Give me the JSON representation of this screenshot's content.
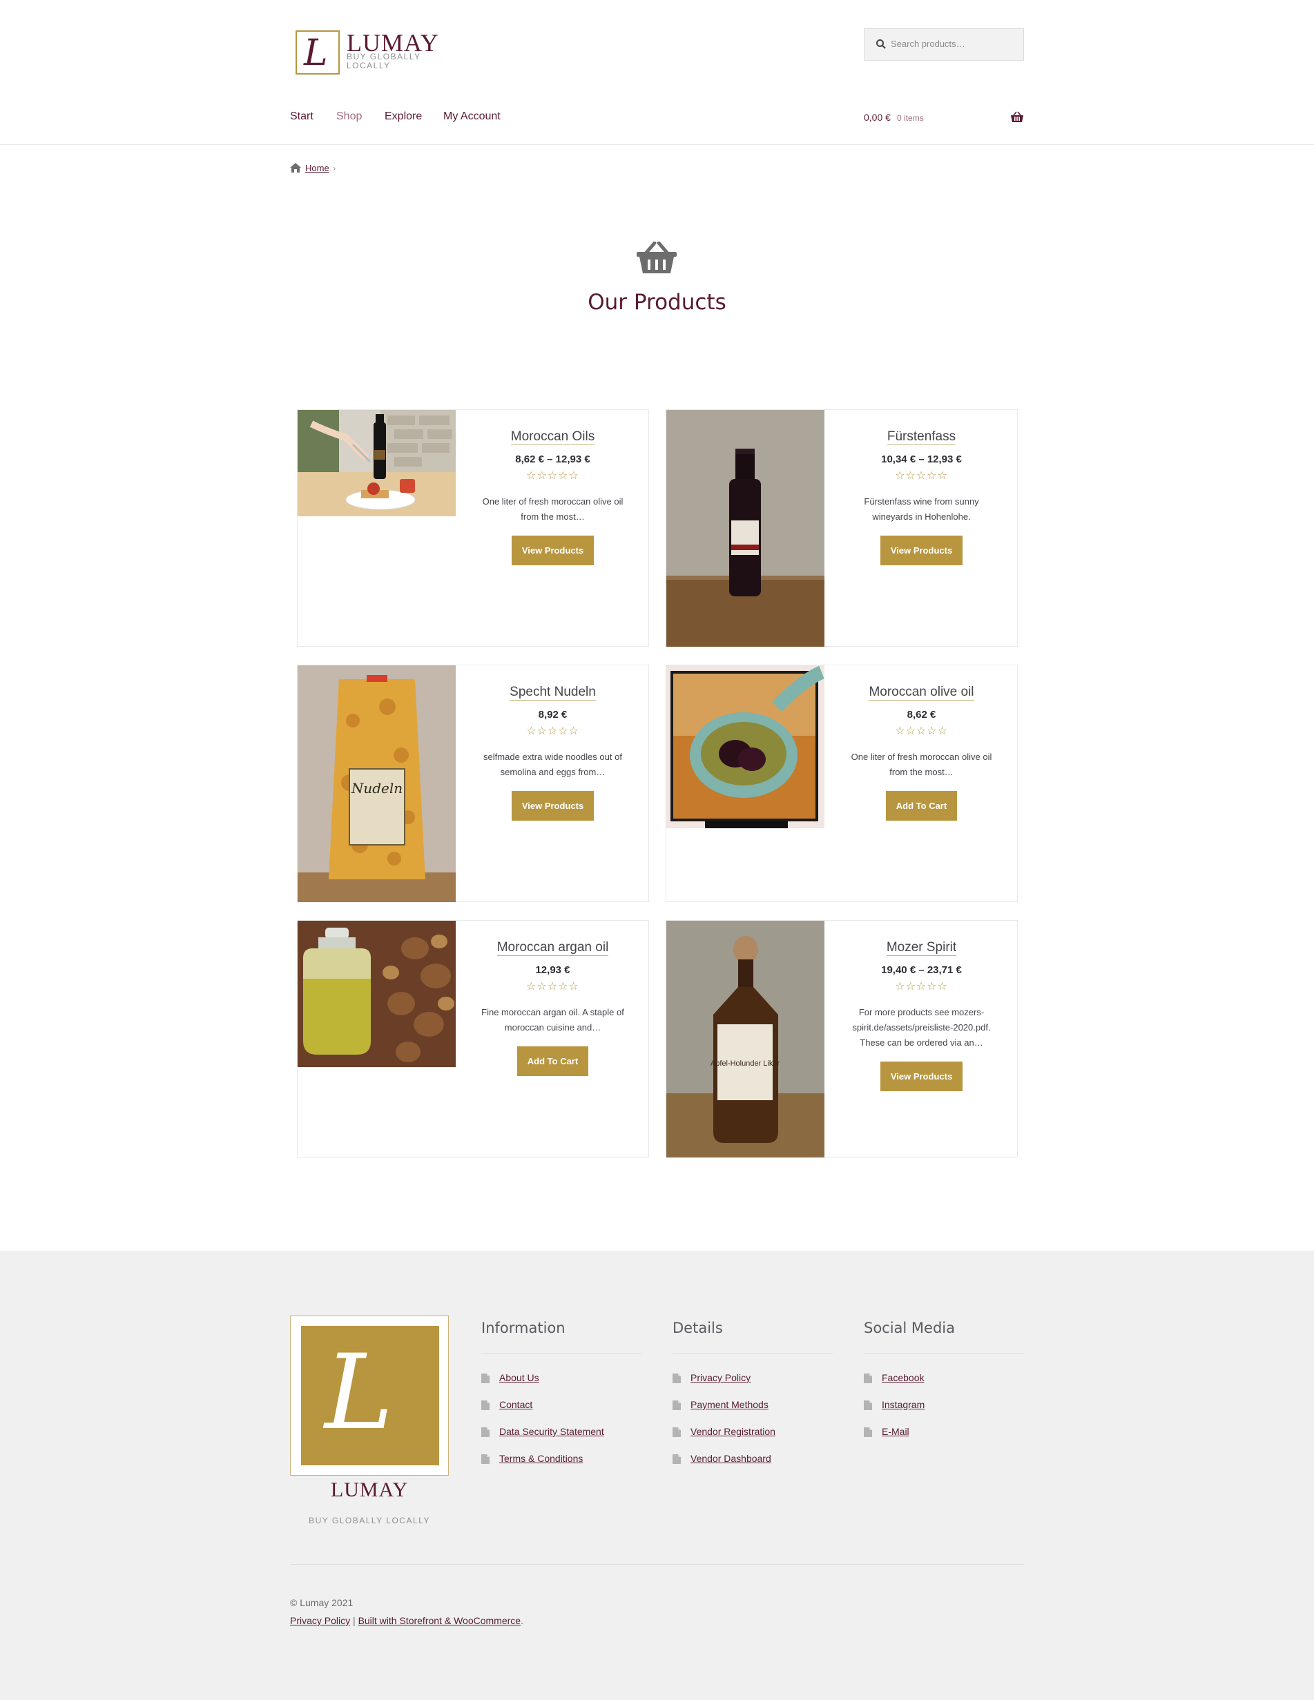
{
  "header": {
    "logo_name": "LUMAY",
    "logo_tagline": "BUY GLOBALLY LOCALLY",
    "search_placeholder": "Search products…",
    "nav": [
      {
        "label": "Start",
        "active": false
      },
      {
        "label": "Shop",
        "active": true
      },
      {
        "label": "Explore",
        "active": false
      },
      {
        "label": "My Account",
        "active": false
      }
    ],
    "cart_amount": "0,00 €",
    "cart_count": "0 items"
  },
  "breadcrumb": {
    "home_label": "Home",
    "separator": "›"
  },
  "page_title": "Our Products",
  "colors": {
    "accent": "#b8953f",
    "brand": "#5a1a33",
    "link_active": "#a26d80",
    "footer_bg": "#f0f0f0"
  },
  "products": [
    {
      "name": "Moroccan Oils",
      "price": "8,62 € – 12,93 €",
      "stars": "☆☆☆☆☆",
      "description": "One liter of fresh moroccan olive oil from the most…",
      "button": "View Products",
      "image": "olive-oil-bottle-with-toast-photo"
    },
    {
      "name": "Fürstenfass",
      "price": "10,34 € – 12,93 €",
      "stars": "☆☆☆☆☆",
      "description": "Fürstenfass wine from sunny wineyards in Hohenlohe.",
      "button": "View Products",
      "image": "wine-bottle-photo"
    },
    {
      "name": "Specht Nudeln",
      "price": "8,92 €",
      "stars": "☆☆☆☆☆",
      "description": "selfmade extra wide noodles out of semolina and eggs from…",
      "button": "View Products",
      "image": "noodle-bag-photo"
    },
    {
      "name": "Moroccan olive oil",
      "price": "8,62 €",
      "stars": "☆☆☆☆☆",
      "description": "One liter of fresh moroccan olive oil from the most…",
      "button": "Add To Cart",
      "image": "olive-oil-spoon-photo"
    },
    {
      "name": "Moroccan argan oil",
      "price": "12,93 €",
      "stars": "☆☆☆☆☆",
      "description": "Fine moroccan argan oil. A staple of moroccan cuisine and…",
      "button": "Add To Cart",
      "image": "argan-oil-jar-photo"
    },
    {
      "name": "Mozer Spirit",
      "price": "19,40 € – 23,71 €",
      "stars": "☆☆☆☆☆",
      "description": "For more products see mozers-spirit.de/assets/preisliste-2020.pdf. These can be ordered via an…",
      "button": "View Products",
      "image": "liqueur-bottle-photo",
      "bottle_label": "Apfel-Holunder Likör"
    }
  ],
  "footer": {
    "logo_name": "LUMAY",
    "logo_tagline": "BUY GLOBALLY LOCALLY",
    "columns": [
      {
        "title": "Information",
        "links": [
          "About Us",
          "Contact",
          "Data Security Statement",
          "Terms & Conditions"
        ]
      },
      {
        "title": "Details",
        "links": [
          "Privacy Policy",
          "Payment Methods",
          "Vendor Registration",
          "Vendor Dashboard"
        ]
      },
      {
        "title": "Social Media",
        "links": [
          "Facebook",
          "Instagram",
          "E-Mail"
        ]
      }
    ],
    "copyright": "© Lumay 2021",
    "bottom_privacy": "Privacy Policy",
    "bottom_separator": "|",
    "bottom_built": "Built with Storefront & WooCommerce",
    "bottom_period": "."
  }
}
